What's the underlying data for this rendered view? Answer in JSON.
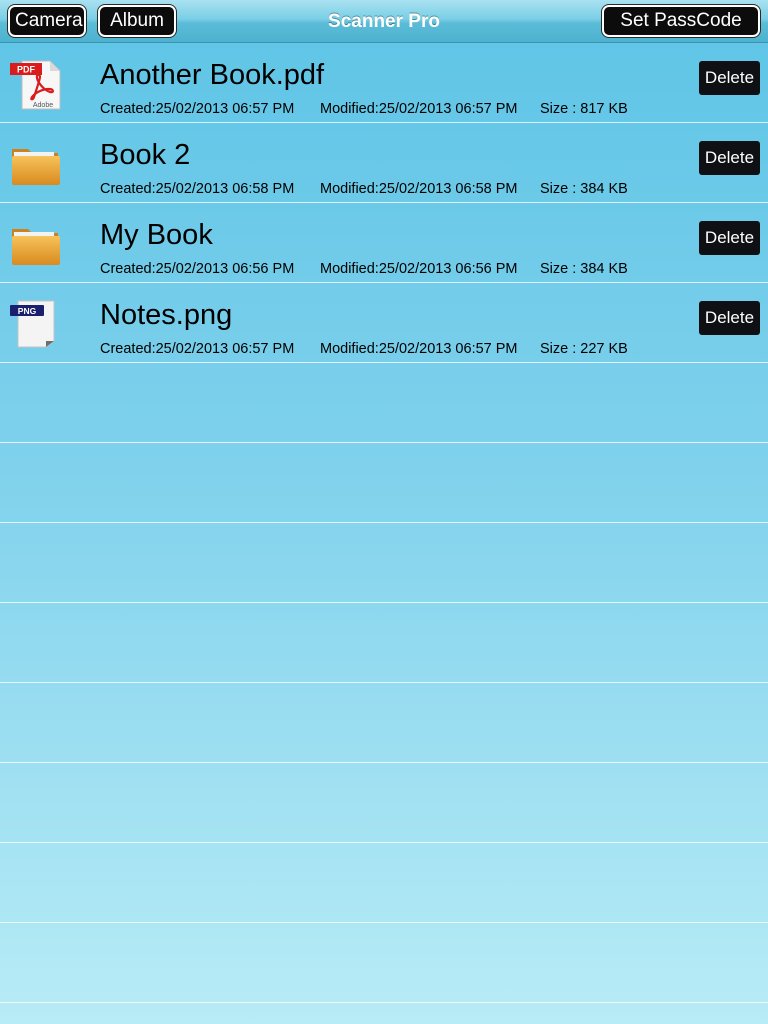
{
  "navbar": {
    "title": "Scanner Pro",
    "camera_label": "Camera",
    "album_label": "Album",
    "passcode_label": "Set PassCode"
  },
  "files": [
    {
      "name": "Another Book.pdf",
      "icon": "pdf-icon",
      "created": "Created:25/02/2013 06:57 PM",
      "modified": "Modified:25/02/2013 06:57 PM",
      "size": "Size : 817 KB",
      "delete_label": "Delete"
    },
    {
      "name": "Book 2",
      "icon": "folder-icon",
      "created": "Created:25/02/2013 06:58 PM",
      "modified": "Modified:25/02/2013 06:58 PM",
      "size": "Size : 384 KB",
      "delete_label": "Delete"
    },
    {
      "name": "My Book",
      "icon": "folder-icon",
      "created": "Created:25/02/2013 06:56 PM",
      "modified": "Modified:25/02/2013 06:56 PM",
      "size": "Size : 384 KB",
      "delete_label": "Delete"
    },
    {
      "name": "Notes.png",
      "icon": "png-icon",
      "created": "Created:25/02/2013 06:57 PM",
      "modified": "Modified:25/02/2013 06:57 PM",
      "size": "Size : 227 KB",
      "delete_label": "Delete"
    }
  ],
  "icons": {
    "pdf_badge": "PDF",
    "pdf_brand": "Adobe",
    "png_badge": "PNG"
  },
  "colors": {
    "background_top": "#5dc4e6",
    "background_bottom": "#b8ecf6",
    "button_bg": "#0c0c0c",
    "pdf_red": "#d91c1c",
    "folder_orange": "#e8a53a",
    "png_badge_bg": "#1a1f6e"
  }
}
